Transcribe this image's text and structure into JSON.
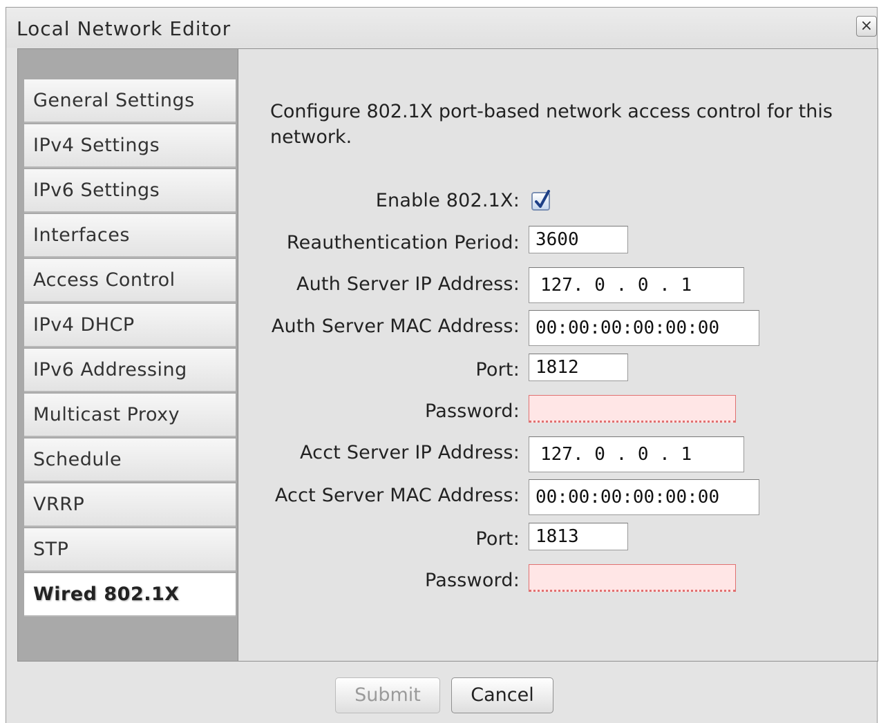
{
  "window": {
    "title": "Local Network Editor",
    "close_glyph": "×"
  },
  "sidebar": {
    "items": [
      {
        "label": "General Settings"
      },
      {
        "label": "IPv4 Settings"
      },
      {
        "label": "IPv6 Settings"
      },
      {
        "label": "Interfaces"
      },
      {
        "label": "Access Control"
      },
      {
        "label": "IPv4 DHCP"
      },
      {
        "label": "IPv6 Addressing"
      },
      {
        "label": "Multicast Proxy"
      },
      {
        "label": "Schedule"
      },
      {
        "label": "VRRP"
      },
      {
        "label": "STP"
      },
      {
        "label": "Wired 802.1X",
        "active": true
      }
    ]
  },
  "content": {
    "description": "Configure 802.1X port-based network access control for this network.",
    "enable": {
      "label": "Enable 802.1X:",
      "checked": true
    },
    "reauth": {
      "label": "Reauthentication Period:",
      "value": "3600"
    },
    "auth_ip": {
      "label": "Auth Server IP Address:",
      "value": "127. 0 . 0 . 1"
    },
    "auth_mac": {
      "label": "Auth Server MAC Address:",
      "value": "00:00:00:00:00:00"
    },
    "auth_port": {
      "label": "Port:",
      "value": "1812"
    },
    "auth_password": {
      "label": "Password:",
      "value": ""
    },
    "acct_ip": {
      "label": "Acct Server IP Address:",
      "value": "127. 0 . 0 . 1"
    },
    "acct_mac": {
      "label": "Acct Server MAC Address:",
      "value": "00:00:00:00:00:00"
    },
    "acct_port": {
      "label": "Port:",
      "value": "1813"
    },
    "acct_password": {
      "label": "Password:",
      "value": ""
    }
  },
  "buttons": {
    "submit_label": "Submit",
    "cancel_label": "Cancel"
  },
  "colors": {
    "error_field": "#ffe6e6",
    "checkbox_check": "#1d3f86"
  },
  "icons": {
    "close": "close-icon",
    "check": "checkmark-icon"
  }
}
